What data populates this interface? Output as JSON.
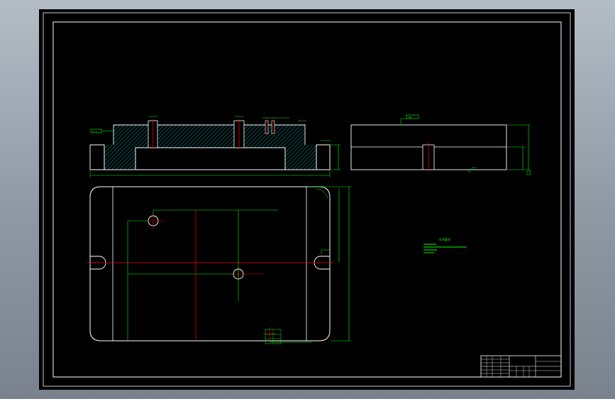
{
  "colors": {
    "background_gradient": [
      "#b4bcc6",
      "#8e97a2",
      "#79828d"
    ],
    "sheet": "#000000",
    "outline": "#ffffff",
    "dimension": "#00ff00",
    "centerline": "#ff0000",
    "hatch": "#00c8c8"
  },
  "section_view": {
    "callout": "A—A"
  },
  "side_view": {
    "callout": "A向"
  },
  "plan_view": {
    "dims": []
  },
  "notes": {
    "title": "技术要求",
    "lines": []
  },
  "title_block": {
    "cells": []
  }
}
